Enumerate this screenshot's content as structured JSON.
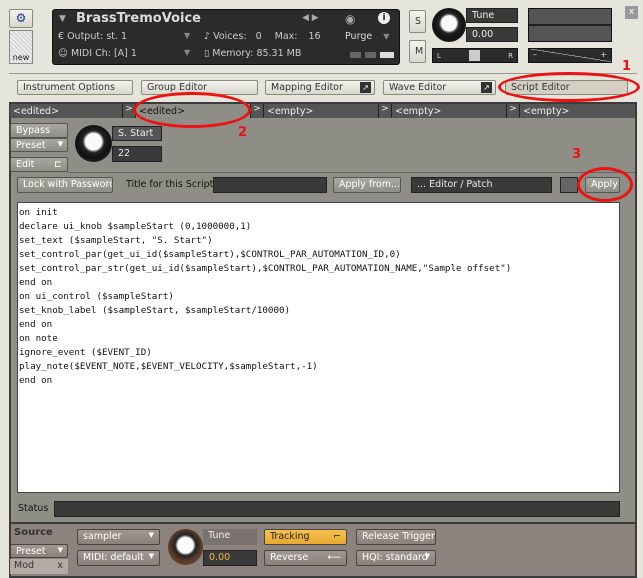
{
  "header": {
    "title": "BrassTremoVoice",
    "output_label": "Output:",
    "output_value": "st. 1",
    "midi_label": "MIDI Ch:",
    "midi_value": "[A] 1",
    "voices_label": "Voices:",
    "voices_value": "0",
    "max_label": "Max:",
    "max_value": "16",
    "memory_label": "Memory:",
    "memory_value": "85.31 MB",
    "purge": "Purge",
    "solo": "S",
    "mute": "M",
    "tune_label": "Tune",
    "tune_value": "0.00",
    "pan_left": "L",
    "pan_right": "R",
    "vol_minus": "–",
    "vol_plus": "+",
    "new_label": "new",
    "close": "x"
  },
  "editor_tabs": [
    {
      "label": "Instrument Options"
    },
    {
      "label": "Group Editor"
    },
    {
      "label": "Mapping Editor"
    },
    {
      "label": "Wave Editor"
    },
    {
      "label": "Script Editor",
      "active": true
    }
  ],
  "script_slots": [
    "<edited>",
    "<edited>",
    "<empty>",
    "<empty>",
    "<empty>"
  ],
  "script_panel": {
    "bypass": "Bypass",
    "preset": "Preset",
    "edit": "Edit",
    "knob_label": "S. Start",
    "knob_value": "22",
    "lock": "Lock with Password",
    "title_label": "Title for this Script",
    "title_value": "",
    "apply_from": "Apply from...",
    "editor_patch": "... Editor / Patch",
    "apply": "Apply"
  },
  "code": "on init\ndeclare ui_knob $sampleStart (0,1000000,1)\nset_text ($sampleStart, \"S. Start\")\nset_control_par(get_ui_id($sampleStart),$CONTROL_PAR_AUTOMATION_ID,0)\nset_control_par_str(get_ui_id($sampleStart),$CONTROL_PAR_AUTOMATION_NAME,\"Sample offset\")\nend on\non ui_control ($sampleStart)\nset_knob_label ($sampleStart, $sampleStart/10000)\nend on\non note\nignore_event ($EVENT_ID)\nplay_note($EVENT_NOTE,$EVENT_VELOCITY,$sampleStart,-1)\nend on",
  "status": {
    "label": "Status",
    "value": ""
  },
  "source": {
    "title": "Source",
    "preset": "Preset",
    "mod": "Mod",
    "mod_close": "x",
    "mode": "sampler",
    "midi": "MIDI: default",
    "tune_label": "Tune",
    "tune_value": "0.00",
    "tracking": "Tracking",
    "reverse": "Reverse",
    "release_trigger": "Release Trigger",
    "hqi": "HQI: standard"
  },
  "annotations": [
    "1",
    "2",
    "3"
  ],
  "colors": {
    "annotation": "#ee1111",
    "tracking_active": "#f0b440",
    "tune_value": "#f0b440"
  }
}
